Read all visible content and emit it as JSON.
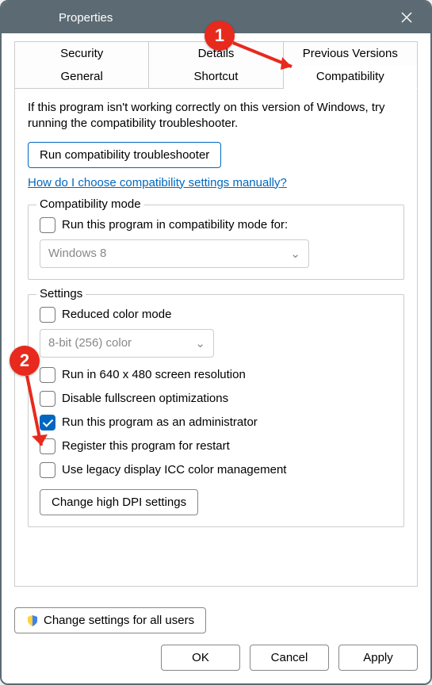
{
  "window": {
    "title": "Properties"
  },
  "tabs": {
    "row1": [
      "Security",
      "Details",
      "Previous Versions"
    ],
    "row2": [
      "General",
      "Shortcut",
      "Compatibility"
    ],
    "active": "Compatibility"
  },
  "intro": "If this program isn't working correctly on this version of Windows, try running the compatibility troubleshooter.",
  "buttons": {
    "troubleshooter": "Run compatibility troubleshooter",
    "dpi": "Change high DPI settings",
    "all_users": "Change settings for all users",
    "ok": "OK",
    "cancel": "Cancel",
    "apply": "Apply"
  },
  "link": "How do I choose compatibility settings manually?",
  "groups": {
    "compat_mode": {
      "label": "Compatibility mode",
      "checkbox": "Run this program in compatibility mode for:",
      "select": "Windows 8"
    },
    "settings": {
      "label": "Settings",
      "reduced_color": "Reduced color mode",
      "color_select": "8-bit (256) color",
      "res_640": "Run in 640 x 480 screen resolution",
      "disable_fs": "Disable fullscreen optimizations",
      "run_admin": "Run this program as an administrator",
      "register_restart": "Register this program for restart",
      "legacy_icc": "Use legacy display ICC color management"
    }
  },
  "annotations": {
    "b1": "1",
    "b2": "2"
  }
}
